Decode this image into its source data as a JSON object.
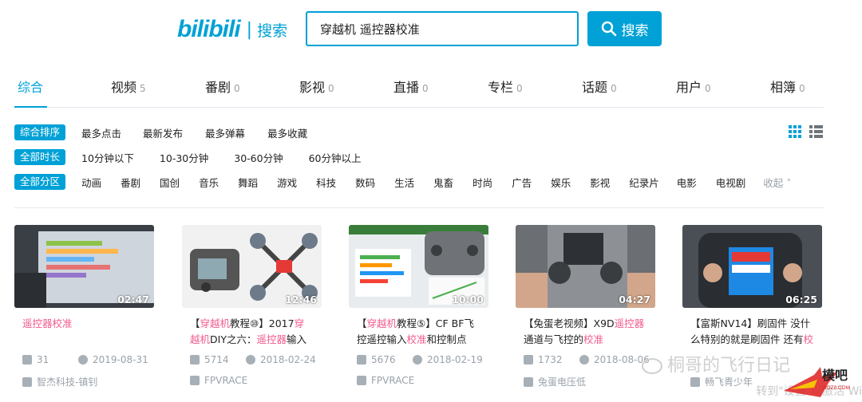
{
  "header": {
    "logo": "bilibili",
    "logo_sub": "搜索",
    "search_value": "穿越机 遥控器校准",
    "search_button": "搜索"
  },
  "tabs": [
    {
      "label": "综合",
      "count": ""
    },
    {
      "label": "视频",
      "count": "5"
    },
    {
      "label": "番剧",
      "count": "0"
    },
    {
      "label": "影视",
      "count": "0"
    },
    {
      "label": "直播",
      "count": "0"
    },
    {
      "label": "专栏",
      "count": "0"
    },
    {
      "label": "话题",
      "count": "0"
    },
    {
      "label": "用户",
      "count": "0"
    },
    {
      "label": "相簿",
      "count": "0"
    }
  ],
  "filters": {
    "sort": {
      "active": "综合排序",
      "options": [
        "最多点击",
        "最新发布",
        "最多弹幕",
        "最多收藏"
      ]
    },
    "duration": {
      "active": "全部时长",
      "options": [
        "10分钟以下",
        "10-30分钟",
        "30-60分钟",
        "60分钟以上"
      ]
    },
    "zone": {
      "active": "全部分区",
      "options": [
        "动画",
        "番剧",
        "国创",
        "音乐",
        "舞蹈",
        "游戏",
        "科技",
        "数码",
        "生活",
        "鬼畜",
        "时尚",
        "广告",
        "娱乐",
        "影视",
        "纪录片",
        "电影",
        "电视剧"
      ],
      "collapse": "收起"
    }
  },
  "videos": [
    {
      "duration": "02:47",
      "title_parts": [
        {
          "t": "遥控器校准",
          "hl": true
        }
      ],
      "plays": "31",
      "date": "2019-08-31",
      "uploader": "智杰科技-镇钊"
    },
    {
      "duration": "12:46",
      "title_parts": [
        {
          "t": "【",
          "hl": false
        },
        {
          "t": "穿越机",
          "hl": true
        },
        {
          "t": "教程⑩】2017",
          "hl": false
        },
        {
          "t": "穿越机",
          "hl": true
        },
        {
          "t": "DIY之六：",
          "hl": false
        },
        {
          "t": "遥控器",
          "hl": true
        },
        {
          "t": "输入的",
          "hl": false
        }
      ],
      "plays": "5714",
      "date": "2018-02-24",
      "uploader": "FPVRACE"
    },
    {
      "duration": "10:00",
      "title_parts": [
        {
          "t": "【",
          "hl": false
        },
        {
          "t": "穿越机",
          "hl": true
        },
        {
          "t": "教程⑤】CF BF飞控遥控输入",
          "hl": false
        },
        {
          "t": "校准",
          "hl": true
        },
        {
          "t": "和控制点",
          "hl": false
        }
      ],
      "plays": "5676",
      "date": "2018-02-19",
      "uploader": "FPVRACE"
    },
    {
      "duration": "04:27",
      "title_parts": [
        {
          "t": "【兔蛋老视频】X9D",
          "hl": false
        },
        {
          "t": "遥控器",
          "hl": true
        },
        {
          "t": "通道与飞控的",
          "hl": false
        },
        {
          "t": "校准",
          "hl": true
        }
      ],
      "plays": "1732",
      "date": "2018-08-06",
      "uploader": "兔蛋电压低"
    },
    {
      "duration": "06:25",
      "title_parts": [
        {
          "t": "【富斯NV14】刷固件 没什么特别的就是刷固件 还有",
          "hl": false
        },
        {
          "t": "校",
          "hl": true
        }
      ],
      "plays": "",
      "date": "",
      "uploader": "畅飞青少年"
    }
  ],
  "watermark": {
    "line1": "桐哥的飞行日记",
    "line2": "转到\"设置\"以激活 Wi",
    "badge": "模吧",
    "badge_sub": "MOZ8.COM"
  },
  "colors": {
    "accent": "#00a1d6",
    "highlight": "#f25d8e",
    "muted": "#99a2aa"
  }
}
